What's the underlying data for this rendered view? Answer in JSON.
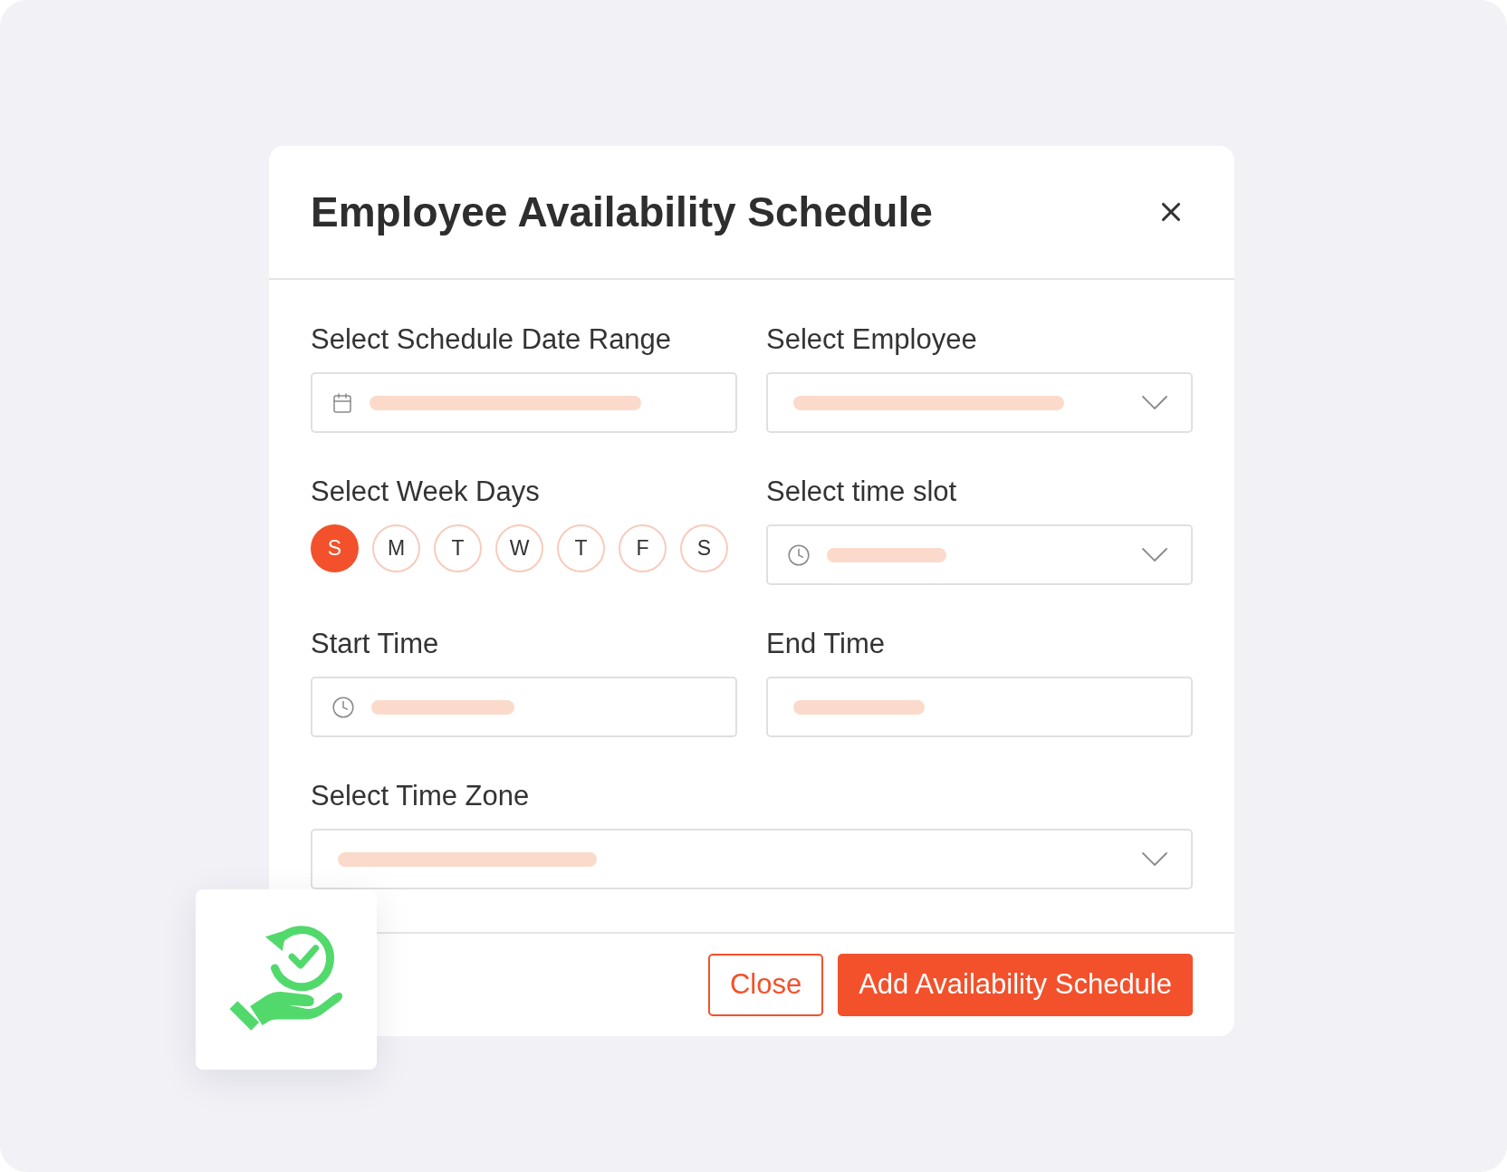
{
  "dialog": {
    "title": "Employee Availability Schedule"
  },
  "rows": [
    [
      {
        "kind": "date",
        "label": "Select Schedule Date Range"
      },
      {
        "kind": "dropdown",
        "label": "Select Employee"
      }
    ],
    [
      {
        "kind": "weekdays",
        "label": "Select Week Days",
        "days": [
          {
            "label": "S",
            "selected": true
          },
          {
            "label": "M",
            "selected": false
          },
          {
            "label": "T",
            "selected": false
          },
          {
            "label": "W",
            "selected": false
          },
          {
            "label": "T",
            "selected": false
          },
          {
            "label": "F",
            "selected": false
          },
          {
            "label": "S",
            "selected": false
          }
        ]
      },
      {
        "kind": "time_dropdown",
        "label": "Select time slot"
      }
    ],
    [
      {
        "kind": "time",
        "label": "Start Time"
      },
      {
        "kind": "text",
        "label": "End Time"
      }
    ],
    [
      {
        "kind": "dropdown",
        "label": "Select Time Zone"
      }
    ]
  ],
  "buttons": [
    {
      "kind": "outline",
      "label": "Close"
    },
    {
      "kind": "primary",
      "label": "Add Availability Schedule"
    }
  ]
}
